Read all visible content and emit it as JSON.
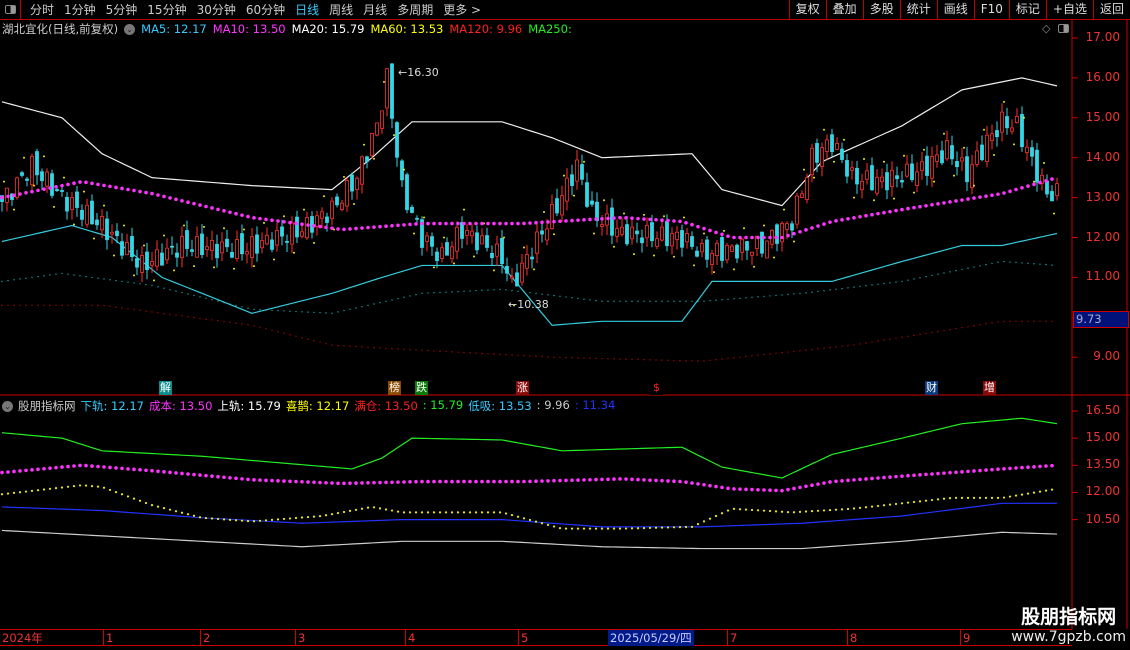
{
  "toolbar": {
    "periods": [
      "分时",
      "1分钟",
      "5分钟",
      "15分钟",
      "30分钟",
      "60分钟",
      "日线",
      "周线",
      "月线",
      "多周期",
      "更多 >"
    ],
    "active_period": "日线",
    "buttons": [
      "复权",
      "叠加",
      "多股",
      "统计",
      "画线",
      "F10",
      "标记",
      "+自选",
      "返回"
    ]
  },
  "main": {
    "title": "湖北宜化(日线,前复权)",
    "ma": [
      {
        "label": "MA5: 12.17",
        "color": "#33ccff"
      },
      {
        "label": "MA10: 13.50",
        "color": "#ff33ff"
      },
      {
        "label": "MA20: 15.79",
        "color": "#ffffff"
      },
      {
        "label": "MA60: 13.53",
        "color": "#ffff00"
      },
      {
        "label": "MA120: 9.96",
        "color": "#ff2020"
      },
      {
        "label": "MA250:",
        "color": "#22ee22"
      }
    ],
    "y_ticks": [
      "17.00",
      "16.00",
      "15.00",
      "14.00",
      "13.00",
      "12.00",
      "11.00",
      "9.00"
    ],
    "current_price": "9.73",
    "high_label": "16.30",
    "low_label": "10.38",
    "events": [
      {
        "char": "解",
        "color": "#0a8a8a"
      },
      {
        "char": "榜",
        "color": "#8a4a00"
      },
      {
        "char": "跌",
        "color": "#0a7a0a"
      },
      {
        "char": "涨",
        "color": "#8a0a0a"
      },
      {
        "char": "$",
        "color": "#000"
      },
      {
        "char": "财",
        "color": "#0a3a7a"
      },
      {
        "char": "增",
        "color": "#8a0a0a"
      }
    ]
  },
  "indicator": {
    "title": "股朋指标网",
    "items": [
      {
        "label": "下轨: 12.17",
        "color": "#33ccff"
      },
      {
        "label": "成本: 13.50",
        "color": "#ff33ff"
      },
      {
        "label": "上轨: 15.79",
        "color": "#ffffff"
      },
      {
        "label": "喜鹊: 12.17",
        "color": "#ffff00"
      },
      {
        "label": "满仓: 13.50",
        "color": "#ff2020"
      },
      {
        "label": ": 15.79",
        "color": "#22ee22"
      },
      {
        "label": "低吸: 13.53",
        "color": "#33ccff"
      },
      {
        "label": ": 9.96",
        "color": "#cccccc"
      },
      {
        "label": ": 11.34",
        "color": "#2233ff"
      }
    ],
    "y_ticks": [
      "16.50",
      "15.00",
      "13.50",
      "12.00",
      "10.50"
    ]
  },
  "date_axis": {
    "labels": [
      "2024年",
      "1",
      "2",
      "3",
      "4",
      "5",
      "7",
      "8",
      "9"
    ],
    "selected": "2025/05/29/四"
  },
  "watermark": {
    "title": "股朋指标网",
    "url": "www.7gpzb.com"
  },
  "series": {
    "close": [
      [
        0,
        12.9
      ],
      [
        6,
        13.8
      ],
      [
        12,
        13.0
      ],
      [
        20,
        12.3
      ],
      [
        28,
        11.3
      ],
      [
        36,
        11.8
      ],
      [
        48,
        11.7
      ],
      [
        60,
        12.2
      ],
      [
        66,
        12.7
      ],
      [
        71,
        13.5
      ],
      [
        75,
        14.8
      ],
      [
        77,
        16.0
      ],
      [
        80,
        13.2
      ],
      [
        84,
        12.0
      ],
      [
        88,
        11.5
      ],
      [
        92,
        12.2
      ],
      [
        100,
        11.5
      ],
      [
        102,
        10.8
      ],
      [
        106,
        11.7
      ],
      [
        111,
        12.8
      ],
      [
        115,
        13.8
      ],
      [
        118,
        12.6
      ],
      [
        124,
        12.1
      ],
      [
        136,
        12.0
      ],
      [
        140,
        11.6
      ],
      [
        152,
        11.8
      ],
      [
        158,
        12.4
      ],
      [
        162,
        14.0
      ],
      [
        166,
        14.4
      ],
      [
        170,
        13.5
      ],
      [
        176,
        13.4
      ],
      [
        184,
        13.7
      ],
      [
        189,
        14.2
      ],
      [
        193,
        13.6
      ],
      [
        197,
        14.4
      ],
      [
        200,
        14.9
      ],
      [
        203,
        14.8
      ],
      [
        206,
        13.9
      ],
      [
        209,
        13.1
      ],
      [
        211,
        13.1
      ]
    ],
    "upper": [
      [
        0,
        15.4
      ],
      [
        12,
        15.0
      ],
      [
        20,
        14.1
      ],
      [
        30,
        13.5
      ],
      [
        50,
        13.3
      ],
      [
        66,
        13.2
      ],
      [
        74,
        14.0
      ],
      [
        82,
        14.9
      ],
      [
        100,
        14.9
      ],
      [
        110,
        14.5
      ],
      [
        120,
        14.0
      ],
      [
        138,
        14.1
      ],
      [
        144,
        13.2
      ],
      [
        156,
        12.8
      ],
      [
        164,
        13.9
      ],
      [
        180,
        14.8
      ],
      [
        192,
        15.7
      ],
      [
        204,
        16.0
      ],
      [
        211,
        15.8
      ]
    ],
    "lower": [
      [
        0,
        11.9
      ],
      [
        14,
        12.3
      ],
      [
        22,
        12.0
      ],
      [
        32,
        11.0
      ],
      [
        50,
        10.1
      ],
      [
        66,
        10.6
      ],
      [
        76,
        11.0
      ],
      [
        84,
        11.3
      ],
      [
        100,
        11.3
      ],
      [
        110,
        9.8
      ],
      [
        120,
        9.9
      ],
      [
        136,
        9.9
      ],
      [
        142,
        10.9
      ],
      [
        166,
        10.9
      ],
      [
        180,
        11.4
      ],
      [
        192,
        11.8
      ],
      [
        200,
        11.8
      ],
      [
        211,
        12.1
      ]
    ],
    "ma": [
      [
        0,
        13.0
      ],
      [
        16,
        13.4
      ],
      [
        30,
        13.1
      ],
      [
        50,
        12.5
      ],
      [
        68,
        12.2
      ],
      [
        84,
        12.35
      ],
      [
        104,
        12.35
      ],
      [
        124,
        12.5
      ],
      [
        136,
        12.4
      ],
      [
        146,
        12.0
      ],
      [
        156,
        12.0
      ],
      [
        166,
        12.4
      ],
      [
        180,
        12.7
      ],
      [
        200,
        13.1
      ],
      [
        211,
        13.5
      ]
    ],
    "ma_red": [
      [
        0,
        10.3
      ],
      [
        20,
        10.3
      ],
      [
        50,
        9.8
      ],
      [
        66,
        9.3
      ],
      [
        80,
        9.2
      ],
      [
        110,
        9.0
      ],
      [
        140,
        8.9
      ],
      [
        170,
        9.3
      ],
      [
        200,
        9.9
      ],
      [
        211,
        9.9
      ]
    ],
    "ma_cyan": [
      [
        0,
        10.9
      ],
      [
        12,
        11.1
      ],
      [
        30,
        10.8
      ],
      [
        50,
        10.2
      ],
      [
        66,
        10.1
      ],
      [
        84,
        10.6
      ],
      [
        100,
        10.7
      ],
      [
        120,
        10.4
      ],
      [
        140,
        10.4
      ],
      [
        160,
        10.6
      ],
      [
        180,
        10.9
      ],
      [
        200,
        11.4
      ],
      [
        211,
        11.3
      ]
    ],
    "ind_green": [
      [
        0,
        15.3
      ],
      [
        12,
        15.0
      ],
      [
        20,
        14.3
      ],
      [
        40,
        14.0
      ],
      [
        70,
        13.3
      ],
      [
        76,
        13.9
      ],
      [
        82,
        15.0
      ],
      [
        100,
        14.9
      ],
      [
        112,
        14.3
      ],
      [
        136,
        14.5
      ],
      [
        144,
        13.4
      ],
      [
        156,
        12.8
      ],
      [
        166,
        14.1
      ],
      [
        180,
        15.0
      ],
      [
        192,
        15.8
      ],
      [
        204,
        16.1
      ],
      [
        211,
        15.8
      ]
    ],
    "ind_magenta": [
      [
        0,
        13.1
      ],
      [
        16,
        13.5
      ],
      [
        30,
        13.2
      ],
      [
        50,
        12.7
      ],
      [
        68,
        12.5
      ],
      [
        84,
        12.6
      ],
      [
        104,
        12.6
      ],
      [
        124,
        12.75
      ],
      [
        136,
        12.6
      ],
      [
        146,
        12.2
      ],
      [
        156,
        12.1
      ],
      [
        166,
        12.6
      ],
      [
        180,
        12.9
      ],
      [
        200,
        13.3
      ],
      [
        211,
        13.5
      ]
    ],
    "ind_yellow": [
      [
        0,
        11.9
      ],
      [
        16,
        12.4
      ],
      [
        20,
        12.3
      ],
      [
        30,
        11.3
      ],
      [
        40,
        10.6
      ],
      [
        50,
        10.4
      ],
      [
        64,
        10.7
      ],
      [
        74,
        11.2
      ],
      [
        80,
        10.9
      ],
      [
        100,
        10.9
      ],
      [
        112,
        10.0
      ],
      [
        124,
        10.0
      ],
      [
        138,
        10.1
      ],
      [
        146,
        11.1
      ],
      [
        158,
        10.9
      ],
      [
        170,
        11.1
      ],
      [
        190,
        11.7
      ],
      [
        200,
        11.7
      ],
      [
        211,
        12.2
      ]
    ],
    "ind_blue": [
      [
        0,
        11.2
      ],
      [
        20,
        11.0
      ],
      [
        40,
        10.6
      ],
      [
        60,
        10.3
      ],
      [
        80,
        10.5
      ],
      [
        100,
        10.5
      ],
      [
        120,
        10.1
      ],
      [
        140,
        10.1
      ],
      [
        160,
        10.3
      ],
      [
        180,
        10.7
      ],
      [
        200,
        11.4
      ],
      [
        211,
        11.4
      ]
    ],
    "ind_grey": [
      [
        0,
        9.9
      ],
      [
        20,
        9.6
      ],
      [
        40,
        9.3
      ],
      [
        60,
        9.0
      ],
      [
        80,
        9.3
      ],
      [
        100,
        9.3
      ],
      [
        120,
        9.0
      ],
      [
        140,
        8.9
      ],
      [
        160,
        8.9
      ],
      [
        180,
        9.3
      ],
      [
        200,
        9.8
      ],
      [
        211,
        9.7
      ]
    ]
  }
}
